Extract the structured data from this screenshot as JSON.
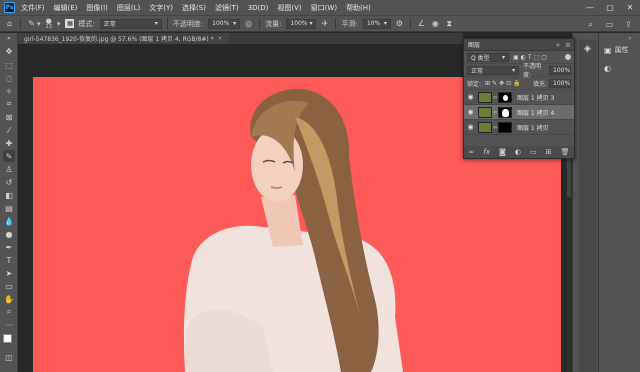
{
  "app": {
    "logo": "Ps"
  },
  "menu": [
    "文件(F)",
    "编辑(E)",
    "图像(I)",
    "图层(L)",
    "文字(Y)",
    "选择(S)",
    "滤镜(T)",
    "3D(D)",
    "视图(V)",
    "窗口(W)",
    "帮助(H)"
  ],
  "window_controls": {
    "minimize": "—",
    "restore": "▢",
    "close": "✕"
  },
  "options": {
    "brush_size": "13",
    "mode_label": "模式:",
    "mode_value": "正常",
    "opacity_label": "不透明度:",
    "opacity_value": "100%",
    "flow_label": "流量:",
    "flow_value": "100%",
    "smooth_label": "平滑:",
    "smooth_value": "10%"
  },
  "document_tab": {
    "title": "girl-547836_1920-恢复的.jpg @ 57.6% (图层 1 拷贝 4, RGB/8#) *",
    "close": "×"
  },
  "layers_panel": {
    "tab": "图层",
    "kind_label": "Q 类型",
    "blend_mode": "正常",
    "opacity_label": "不透明度:",
    "opacity_value": "100%",
    "lock_label": "锁定:",
    "fill_label": "填充:",
    "fill_value": "100%",
    "layers": [
      {
        "name": "图层 1 拷贝 3",
        "mask": "black-with-white",
        "selected": false
      },
      {
        "name": "图层 1 拷贝 4",
        "mask": "white-silhouette",
        "selected": true
      },
      {
        "name": "图层 1 拷贝",
        "mask": "black",
        "selected": false
      }
    ],
    "footer_icons": [
      "link-icon",
      "fx-icon",
      "mask-icon",
      "adjustment-icon",
      "group-icon",
      "new-layer-icon",
      "trash-icon"
    ]
  },
  "dock": {
    "properties_label": "属性"
  },
  "colors": {
    "canvas_bg": "#fd5a58",
    "ui_dark": "#535353",
    "workspace": "#282828"
  }
}
